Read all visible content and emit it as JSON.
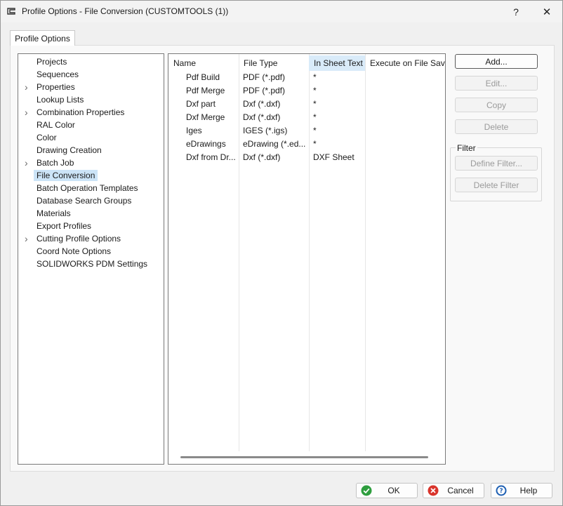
{
  "window": {
    "title": "Profile Options - File Conversion (CUSTOMTOOLS (1))",
    "help_glyph": "?",
    "close_glyph": "✕"
  },
  "tab": {
    "label": "Profile Options"
  },
  "tree": {
    "items": [
      {
        "label": "Projects",
        "expandable": false,
        "selected": false
      },
      {
        "label": "Sequences",
        "expandable": false,
        "selected": false
      },
      {
        "label": "Properties",
        "expandable": true,
        "selected": false
      },
      {
        "label": "Lookup Lists",
        "expandable": false,
        "selected": false
      },
      {
        "label": "Combination Properties",
        "expandable": true,
        "selected": false
      },
      {
        "label": "RAL Color",
        "expandable": false,
        "selected": false
      },
      {
        "label": "Color",
        "expandable": false,
        "selected": false
      },
      {
        "label": "Drawing Creation",
        "expandable": false,
        "selected": false
      },
      {
        "label": "Batch Job",
        "expandable": true,
        "selected": false
      },
      {
        "label": "File Conversion",
        "expandable": false,
        "selected": true
      },
      {
        "label": "Batch Operation Templates",
        "expandable": false,
        "selected": false
      },
      {
        "label": "Database Search Groups",
        "expandable": false,
        "selected": false
      },
      {
        "label": "Materials",
        "expandable": false,
        "selected": false
      },
      {
        "label": "Export Profiles",
        "expandable": false,
        "selected": false
      },
      {
        "label": "Cutting Profile Options",
        "expandable": true,
        "selected": false
      },
      {
        "label": "Coord Note Options",
        "expandable": false,
        "selected": false
      },
      {
        "label": "SOLIDWORKS PDM Settings",
        "expandable": false,
        "selected": false
      }
    ]
  },
  "grid": {
    "columns": [
      "Name",
      "File Type",
      "In Sheet Text",
      "Execute on File Save"
    ],
    "rows": [
      [
        "Pdf Build",
        "PDF (*.pdf)",
        "*",
        ""
      ],
      [
        "Pdf Merge",
        "PDF (*.pdf)",
        "*",
        ""
      ],
      [
        "Dxf part",
        "Dxf (*.dxf)",
        "*",
        ""
      ],
      [
        "Dxf Merge",
        "Dxf (*.dxf)",
        "*",
        ""
      ],
      [
        "Iges",
        "IGES (*.igs)",
        "*",
        ""
      ],
      [
        "eDrawings",
        "eDrawing (*.ed...",
        "*",
        ""
      ],
      [
        "Dxf from Dr...",
        "Dxf (*.dxf)",
        "DXF Sheet",
        ""
      ]
    ]
  },
  "actions": {
    "add": "Add...",
    "edit": "Edit...",
    "copy": "Copy",
    "delete": "Delete"
  },
  "filter": {
    "legend": "Filter",
    "define": "Define Filter...",
    "delete": "Delete Filter"
  },
  "footer": {
    "ok": "OK",
    "cancel": "Cancel",
    "help": "Help"
  },
  "colors": {
    "selection": "#cce4f7",
    "ok_icon": "#2e9e3e",
    "cancel_icon": "#d9342b",
    "help_icon": "#1d5fb3"
  }
}
